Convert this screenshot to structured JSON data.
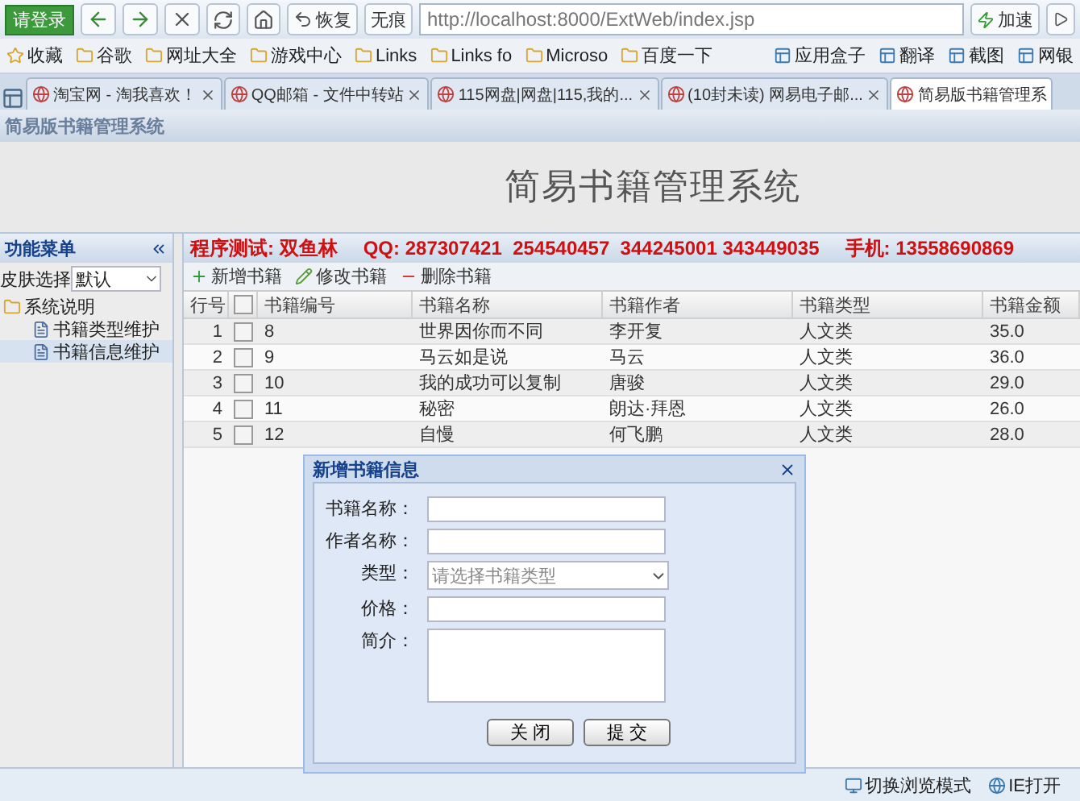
{
  "browser": {
    "login_button": "请登录",
    "restore": "恢复",
    "incognito": "无痕",
    "address": "http://localhost:8000/ExtWeb/index.jsp",
    "accelerate": "加速",
    "bookmarks": [
      "收藏",
      "谷歌",
      "网址大全",
      "游戏中心",
      "Links",
      "Links fo",
      "Microso",
      "百度一下"
    ],
    "tools": [
      "应用盒子",
      "翻译",
      "截图",
      "网银"
    ],
    "tabs": [
      {
        "label": "淘宝网 - 淘我喜欢！",
        "selected": false
      },
      {
        "label": "QQ邮箱 - 文件中转站",
        "selected": false
      },
      {
        "label": "115网盘|网盘|115,我的...",
        "selected": false
      },
      {
        "label": "(10封未读) 网易电子邮...",
        "selected": false
      },
      {
        "label": "简易版书籍管理系",
        "selected": true
      }
    ]
  },
  "page_title": "简易版书籍管理系统",
  "header_title": "简易书籍管理系统",
  "sidebar": {
    "title": "功能菜单",
    "skin_label": "皮肤选择",
    "skin_value": "默认",
    "tree": [
      {
        "label": "系统说明",
        "selected": false,
        "children": [
          {
            "label": "书籍类型维护",
            "selected": false
          },
          {
            "label": "书籍信息维护",
            "selected": true
          }
        ]
      }
    ]
  },
  "info_line": [
    "程序测试: 双鱼林",
    "QQ: 287307421  254540457  344245001 343449035",
    "手机: 13558690869"
  ],
  "toolbar": [
    {
      "label": "新增书籍",
      "kind": "add"
    },
    {
      "label": "修改书籍",
      "kind": "edit"
    },
    {
      "label": "删除书籍",
      "kind": "delete"
    }
  ],
  "table": {
    "columns": [
      "行号",
      "",
      "书籍编号",
      "书籍名称",
      "书籍作者",
      "书籍类型",
      "书籍金额"
    ],
    "all_checked": false,
    "rows": [
      {
        "checked": false,
        "cells": [
          "1",
          "",
          "8",
          "世界因你而不同",
          "李开复",
          "人文类",
          "35.0"
        ]
      },
      {
        "checked": false,
        "cells": [
          "2",
          "",
          "9",
          "马云如是说",
          "马云",
          "人文类",
          "36.0"
        ]
      },
      {
        "checked": false,
        "cells": [
          "3",
          "",
          "10",
          "我的成功可以复制",
          "唐骏",
          "人文类",
          "29.0"
        ]
      },
      {
        "checked": false,
        "cells": [
          "4",
          "",
          "11",
          "秘密",
          "朗达·拜恩",
          "人文类",
          "26.0"
        ]
      },
      {
        "checked": false,
        "cells": [
          "5",
          "",
          "12",
          "自慢",
          "何飞鹏",
          "人文类",
          "28.0"
        ]
      }
    ]
  },
  "dialog": {
    "title": "新增书籍信息",
    "fields": [
      {
        "label": "书籍名称：",
        "kind": "text"
      },
      {
        "label": "作者名称：",
        "kind": "text"
      },
      {
        "label": "类型：",
        "kind": "select",
        "placeholder": "请选择书籍类型"
      },
      {
        "label": "价格：",
        "kind": "text"
      },
      {
        "label": "简介：",
        "kind": "textarea"
      }
    ],
    "buttons": [
      "关 闭",
      "提 交"
    ]
  },
  "status_bar": [
    "切换浏览模式",
    "IE打开"
  ]
}
